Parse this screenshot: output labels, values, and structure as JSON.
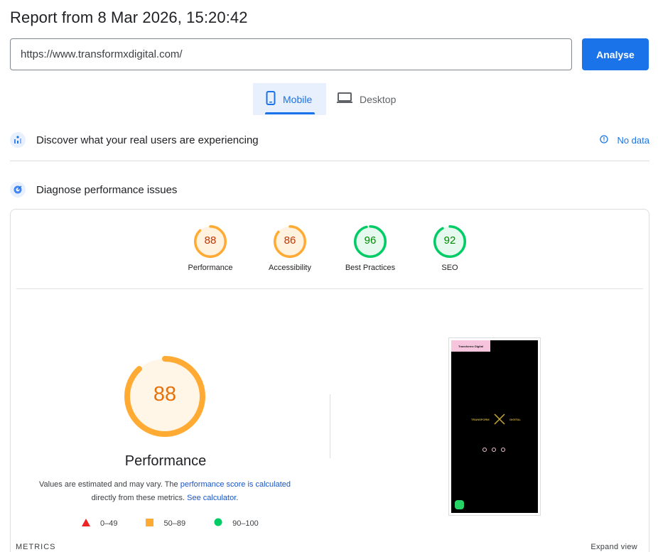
{
  "header": {
    "title": "Report from 8 Mar 2026, 15:20:42"
  },
  "url_input": {
    "value": "https://www.transformxdigital.com/"
  },
  "analyse_button": {
    "label": "Analyse"
  },
  "tabs": [
    {
      "label": "Mobile",
      "selected": true,
      "icon": "mobile-icon"
    },
    {
      "label": "Desktop",
      "selected": false,
      "icon": "desktop-icon"
    }
  ],
  "sections": {
    "discover": {
      "label": "Discover what your real users are experiencing",
      "status": "No data",
      "icon": "users-chart-icon"
    },
    "diagnose": {
      "label": "Diagnose performance issues",
      "icon": "lighthouse-icon"
    }
  },
  "scores": [
    {
      "label": "Performance",
      "value": 88,
      "color": "#fa3",
      "text_color": "#c33300"
    },
    {
      "label": "Accessibility",
      "value": 86,
      "color": "#fa3",
      "text_color": "#c33300"
    },
    {
      "label": "Best Practices",
      "value": 96,
      "color": "#0c6",
      "text_color": "#008800"
    },
    {
      "label": "SEO",
      "value": 92,
      "color": "#0c6",
      "text_color": "#008800"
    }
  ],
  "performance": {
    "score": 88,
    "title": "Performance",
    "disclaimer_prefix": "Values are estimated and may vary. The ",
    "disclaimer_link": "performance score is calculated",
    "disclaimer_middle": "directly from these metrics. ",
    "calculator_link": "See calculator",
    "disclaimer_suffix": "."
  },
  "legend": [
    {
      "shape": "triangle",
      "color": "#e22",
      "range": "0–49"
    },
    {
      "shape": "square",
      "color": "#fa3",
      "range": "50–89"
    },
    {
      "shape": "circle",
      "color": "#0c6",
      "range": "90–100"
    }
  ],
  "screenshot": {
    "badge": "Transformx Digital",
    "logo_left": "TRANSFORM",
    "logo_right": "DIGITAL"
  },
  "footer": {
    "metrics_label": "METRICS",
    "expand_label": "Expand view"
  }
}
